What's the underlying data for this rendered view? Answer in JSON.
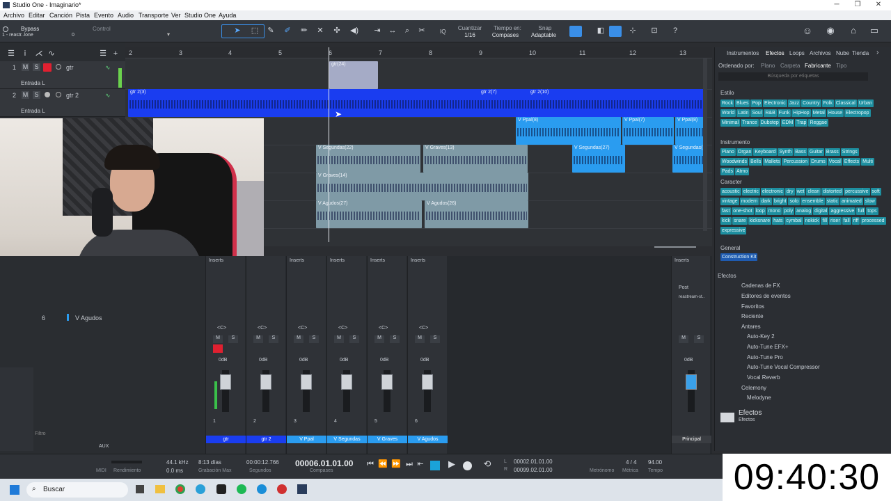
{
  "window": {
    "title": "Studio One - Imaginario*",
    "btn_min": "─",
    "btn_max": "❐",
    "btn_close": "✕"
  },
  "menu": [
    "Archivo",
    "Editar",
    "Canción",
    "Pista",
    "Evento",
    "Audio",
    "Transporte",
    "Ver",
    "Studio One",
    "Ayuda"
  ],
  "toolbar": {
    "bypass": "Bypass",
    "preset": "1 - reastr..lone",
    "preset_val": "0",
    "control": "Control",
    "quantize_label": "Cuantizar",
    "quantize_val": "1/16",
    "timebase_label": "Tiempo en:",
    "timebase_val": "Compases",
    "snap_label": "Snap",
    "snap_val": "Adaptable",
    "iq": "IQ"
  },
  "tracks": [
    {
      "num": "1",
      "name": "gtr",
      "input": "Entrada L",
      "m": "M",
      "s": "S"
    },
    {
      "num": "2",
      "name": "gtr 2",
      "input": "Entrada L",
      "m": "M",
      "s": "S"
    }
  ],
  "mini_track": {
    "num": "6",
    "name": "V Agudos"
  },
  "ruler": [
    "2",
    "3",
    "4",
    "5",
    "6",
    "7",
    "8",
    "9",
    "10",
    "11",
    "12",
    "13"
  ],
  "clips": [
    "gtr(24)",
    "gtr 2(3)",
    "gtr 2(7)",
    "gtr 2(10)",
    "V Ppal(8)",
    "V Ppal(7)",
    "V Ppal(8)",
    "V Segundas(22)",
    "V Graves(13)",
    "V Segundas(27)",
    "V Segundas(",
    "V Graves(14)",
    "V Agudos(27)",
    "V Agudos(26)"
  ],
  "browser": {
    "tabs": [
      "Instrumentos",
      "Efectos",
      "Loops",
      "Archivos",
      "Nube",
      "Tienda"
    ],
    "sort_label": "Ordenado por:",
    "sort_opts": [
      "Plano",
      "Carpeta",
      "Fabricante",
      "Tipo"
    ],
    "search_placeholder": "Búsqueda por etiquetas",
    "estilo_title": "Estilo",
    "estilo": [
      "Rock",
      "Blues",
      "Pop",
      "Electronic",
      "Jazz",
      "Country",
      "Folk",
      "Classical",
      "Urban",
      "World",
      "Latin",
      "Soul",
      "R&B",
      "Funk",
      "HipHop",
      "Metal",
      "House",
      "Electropop",
      "Minimal",
      "Trance",
      "Dubstep",
      "EDM",
      "Trap",
      "Reggae"
    ],
    "instrumento_title": "Instrumento",
    "instrumento": [
      "Piano",
      "Organ",
      "Keyboard",
      "Synth",
      "Bass",
      "Guitar",
      "Brass",
      "Strings",
      "Woodwinds",
      "Bells",
      "Mallets",
      "Percussion",
      "Drums",
      "Vocal",
      "Effects",
      "Multi",
      "Pads",
      "Atmo"
    ],
    "caracter_title": "Caracter",
    "caracter": [
      "acoustic",
      "electric",
      "electronic",
      "dry",
      "wet",
      "clean",
      "distorted",
      "percussive",
      "soft",
      "vintage",
      "modern",
      "dark",
      "bright",
      "solo",
      "ensemble",
      "static",
      "animated",
      "slow",
      "fast",
      "one-shot",
      "loop",
      "mono",
      "poly",
      "analog",
      "digital",
      "aggressive",
      "full",
      "tops",
      "kick",
      "snare",
      "kicksnare",
      "hats",
      "cymbal",
      "nokick",
      "fill",
      "riser",
      "fall",
      "riff",
      "processed",
      "expressive"
    ],
    "general_title": "General",
    "general": "Construction Kit",
    "efectos_title": "Efectos",
    "tree": [
      "Cadenas de FX",
      "Editores de eventos",
      "Favoritos",
      "Reciente",
      "Antares",
      "Auto-Key 2",
      "Auto-Tune EFX+",
      "Auto-Tune Pro",
      "Auto-Tune Vocal Compressor",
      "Vocal Reverb",
      "Celemony",
      "Melodyne"
    ],
    "footer_title": "Efectos",
    "footer_sub": "Efectos"
  },
  "mixer": {
    "inserts": "Inserts",
    "pan": "<C>",
    "db": "0dB",
    "auto": "Auto: de",
    "strips": [
      {
        "num": "1",
        "name": "gtr",
        "color": "#1a3df0"
      },
      {
        "num": "2",
        "name": "gtr 2",
        "color": "#1a3df0"
      },
      {
        "num": "3",
        "name": "V Ppal",
        "color": "#2a9cf0"
      },
      {
        "num": "4",
        "name": "V Segundas",
        "color": "#2a9cf0"
      },
      {
        "num": "5",
        "name": "V Graves",
        "color": "#2a9cf0"
      },
      {
        "num": "6",
        "name": "V Agudos",
        "color": "#2a9cf0"
      }
    ],
    "main": {
      "name": "Principal",
      "post": "Post",
      "send": "reastream-st.."
    },
    "filter": "Filtro",
    "aux": "AUX"
  },
  "transport": {
    "midi": "MIDI",
    "perf": "Rendimiento",
    "rate": "44.1 kHz",
    "latency": "0.0 ms",
    "rec_days": "8:13 días",
    "rec_max": "Grabación Max",
    "seconds": "00:00:12.766",
    "seconds_lbl": "Segundos",
    "position": "00006.01.01.00",
    "position_lbl": "Compases",
    "loop_l": "00002.01.01.00",
    "loop_r": "00099.02.01.00",
    "l": "L",
    "r": "R",
    "metro": "Metrónomo",
    "sig": "4 / 4",
    "metric": "Métrica",
    "tempo": "94.00",
    "tempo_lbl": "Tempo"
  },
  "taskbar": {
    "search": "Buscar"
  },
  "clock": "09:40:30",
  "colors": {
    "dark_blue": "#1a3df0",
    "light_blue": "#2a9cf0",
    "grey_clip": "#7f9aa6",
    "tag": "#1e8fa0"
  }
}
